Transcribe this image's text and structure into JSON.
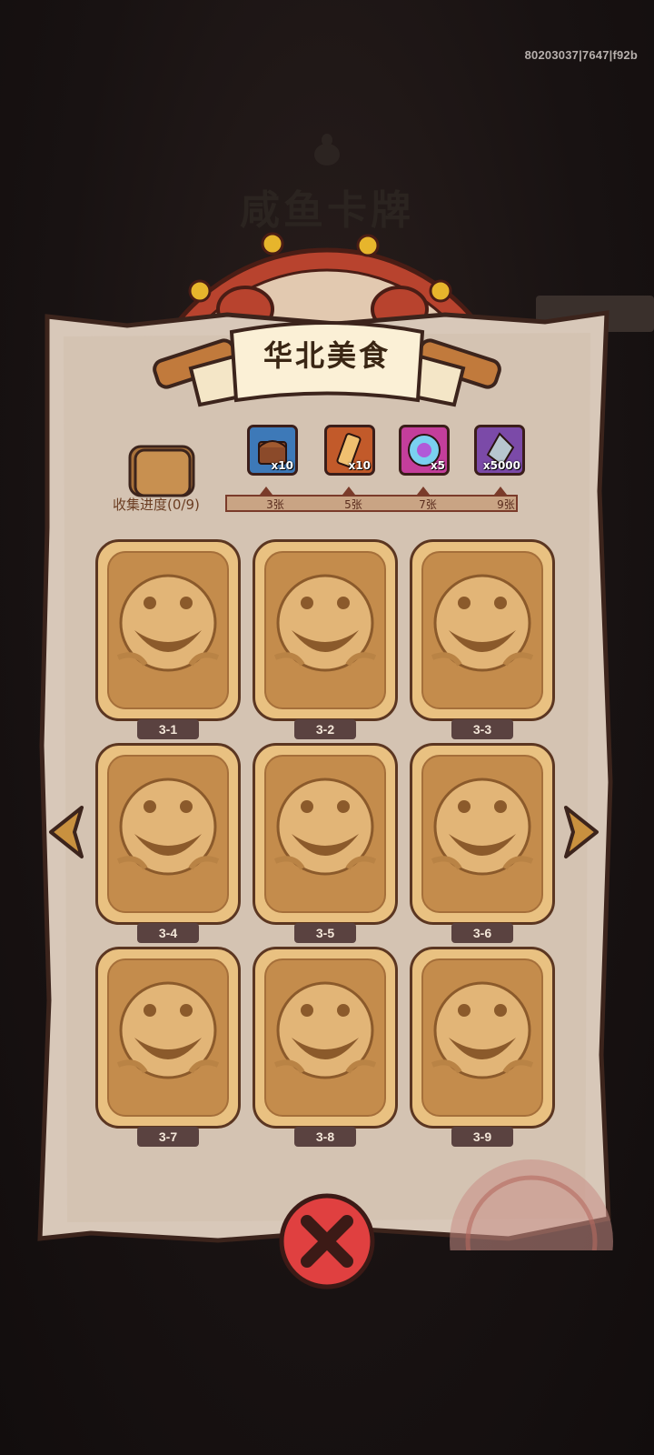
{
  "build_id": "80203037|7647|f92b",
  "background_title": "咸鱼卡牌",
  "banner_title": "华北美食",
  "collection": {
    "label": "收集进度(0/9)",
    "collected": 0,
    "total": 9
  },
  "milestones": [
    {
      "qty": "x10",
      "label": "3张",
      "icon": "treasure-chest-icon",
      "color": "#3d79b8"
    },
    {
      "qty": "x10",
      "label": "5张",
      "icon": "scroll-pen-icon",
      "color": "#c25a2a"
    },
    {
      "qty": "x5",
      "label": "7张",
      "icon": "magic-orb-icon",
      "color": "#c43e9b"
    },
    {
      "qty": "x5000",
      "label": "9张",
      "icon": "crystal-icon",
      "color": "#7b4aa8"
    }
  ],
  "cards": [
    {
      "label": "3-1"
    },
    {
      "label": "3-2"
    },
    {
      "label": "3-3"
    },
    {
      "label": "3-4"
    },
    {
      "label": "3-5"
    },
    {
      "label": "3-6"
    },
    {
      "label": "3-7"
    },
    {
      "label": "3-8"
    },
    {
      "label": "3-9"
    }
  ],
  "colors": {
    "parchment": "#d8c8b9",
    "card_gold": "#e9c181",
    "tag_bg": "#5a4240",
    "close_red": "#e04040"
  }
}
